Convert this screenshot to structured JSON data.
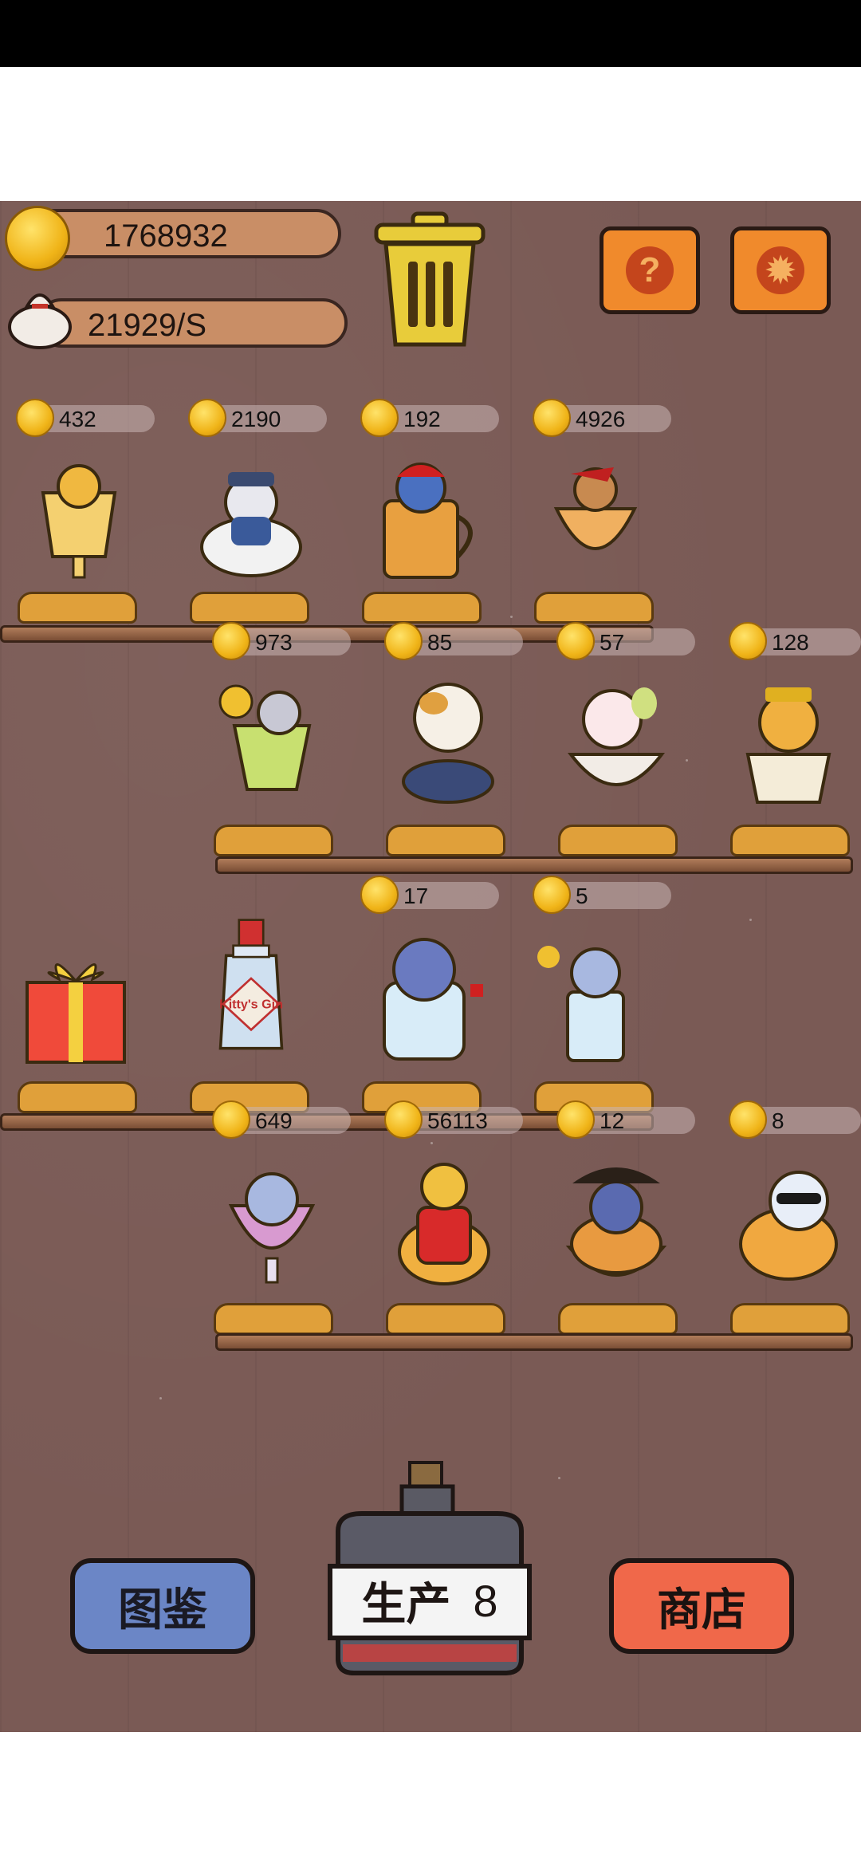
{
  "resources": {
    "coins": "1768932",
    "income": "21929/S"
  },
  "header": {
    "trash": "trash-can-icon",
    "help_icon": "question-icon",
    "settings_icon": "gear-icon"
  },
  "shelves": [
    {
      "items": [
        {
          "name": "cat-in-goblet",
          "price": "432"
        },
        {
          "name": "cat-in-teacup",
          "price": "2190"
        },
        {
          "name": "cat-in-beer-mug",
          "price": "192"
        },
        {
          "name": "cat-in-sundae-glass",
          "price": "4926"
        }
      ]
    },
    {
      "items": [
        {
          "name": "cat-in-lime-glass",
          "price": "973"
        },
        {
          "name": "calico-cat-in-bowl",
          "price": "85"
        },
        {
          "name": "cat-in-noodle-bowl",
          "price": "57"
        },
        {
          "name": "emperor-cat-in-bowl",
          "price": "128"
        }
      ]
    },
    {
      "items": [
        {
          "name": "gift-box",
          "price": ""
        },
        {
          "name": "kittys-gin-bottle",
          "price": "",
          "label": "Kitty's Gin"
        },
        {
          "name": "cat-in-ice-glass",
          "price": "17"
        },
        {
          "name": "cat-in-soda-glass",
          "price": "5"
        }
      ]
    },
    {
      "items": [
        {
          "name": "cat-in-wine-glass",
          "price": "649"
        },
        {
          "name": "cat-in-teapot",
          "price": "56113"
        },
        {
          "name": "pirate-cat-in-pot",
          "price": "12"
        },
        {
          "name": "sunglasses-cat-in-basket",
          "price": "8"
        }
      ]
    }
  ],
  "footer": {
    "collection_label": "图鉴",
    "produce_label": "生产",
    "produce_count": "8",
    "shop_label": "商店"
  },
  "colors": {
    "wood": "#7a5a55",
    "coin": "#f0b418",
    "collection": "#6b86c6",
    "shop": "#f0684a"
  }
}
